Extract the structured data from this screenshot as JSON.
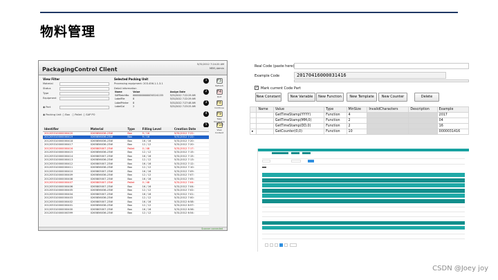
{
  "slide": {
    "title": "物料管理",
    "watermark": "CSDN @Joey joy"
  },
  "shot1": {
    "app_title": "PackagingControl Client",
    "datetime": "5/31/2012 7:24:20 AM",
    "user": "MEK\\ Admin",
    "view_filter": {
      "title": "View Filter",
      "labels": [
        "Material",
        "Status",
        "Type",
        "Equipment"
      ],
      "part_label": "Part",
      "packing_unit_label": "Packing Unit",
      "radio_options": [
        "Box",
        "Pallet",
        "SAP PO"
      ]
    },
    "selected_unit": {
      "title": "Selected Packing Unit",
      "processing_equipment": "Processing equipment: 203.456.1.1.3.1",
      "detail_title": "Detail information",
      "headers": [
        "Name",
        "Value",
        "Assign Date"
      ],
      "rows": [
        [
          "SAPBatchNo",
          "000000000000345241155",
          "5/31/2012 7:22:29 AM"
        ],
        [
          "LabelFile",
          "8",
          "5/31/2012 7:22:29 AM"
        ],
        [
          "LabelPrinter",
          "8",
          "5/31/2012 7:27:48 AM"
        ],
        [
          "LabelCol",
          "2",
          "5/31/2012 7:23:25 AM"
        ]
      ]
    },
    "toolbar": [
      {
        "num": "1",
        "label": "Refresh",
        "icon": "F3"
      },
      {
        "num": "2",
        "label": "Quit",
        "icon": "F4"
      },
      {
        "num": "3",
        "label": "Continue",
        "icon": "F8"
      },
      {
        "num": "4",
        "label": "Take Ownership",
        "icon": "F9"
      },
      {
        "num": "5",
        "label": "View Content",
        "icon": "F10"
      }
    ],
    "grid": {
      "headers": [
        "Identifier",
        "Material",
        "Type",
        "Filling Level",
        "Creation Date"
      ],
      "rows": [
        {
          "c": [
            "201205310000000420",
            "0265856036-23W",
            "Box",
            "9 / 16",
            "5/31/2012 7:22:"
          ],
          "s": "red"
        },
        {
          "c": [
            "201205310000000419",
            "0265856036-23W",
            "Box",
            "9 / 16",
            "5/31/2012 7:22:"
          ],
          "s": "sel"
        },
        {
          "c": [
            "201205310000000418",
            "0265856036-23W",
            "Box",
            "16 / 16",
            "5/31/2012 7:20:"
          ],
          "s": ""
        },
        {
          "c": [
            "201205310000000417",
            "0265856036-23W",
            "Box",
            "12 / 12",
            "5/31/2012 7:20:"
          ],
          "s": ""
        },
        {
          "c": [
            "201205310000000416",
            "0265805007-23W",
            "Pallet",
            "0 / 48",
            "5/31/2012 7:17:"
          ],
          "s": "red"
        },
        {
          "c": [
            "201205310000000415",
            "0265856036-23W",
            "Box",
            "12 / 12",
            "5/31/2012 7:15:"
          ],
          "s": ""
        },
        {
          "c": [
            "201205310000000414",
            "0265805007-23W",
            "Box",
            "16 / 16",
            "5/31/2012 7:15:"
          ],
          "s": ""
        },
        {
          "c": [
            "201205310000000413",
            "0265856036-23W",
            "Box",
            "12 / 12",
            "5/31/2012 7:13:"
          ],
          "s": ""
        },
        {
          "c": [
            "201205310000000412",
            "0265805007-23W",
            "Box",
            "16 / 16",
            "5/31/2012 7:12:"
          ],
          "s": ""
        },
        {
          "c": [
            "201205310000000411",
            "0265856036-23W",
            "Box",
            "12 / 12",
            "5/31/2012 7:10:"
          ],
          "s": ""
        },
        {
          "c": [
            "201205310000000410",
            "0265805007-23W",
            "Box",
            "16 / 16",
            "5/31/2012 7:09:"
          ],
          "s": ""
        },
        {
          "c": [
            "201205310000000409",
            "0265856036-23W",
            "Box",
            "12 / 12",
            "5/31/2012 7:07:"
          ],
          "s": ""
        },
        {
          "c": [
            "201205310000000408",
            "0265805007-23W",
            "Box",
            "16 / 16",
            "5/31/2012 7:05:"
          ],
          "s": ""
        },
        {
          "c": [
            "201205310000000407",
            "0265805007-23W",
            "Pallet",
            "0 / 48",
            "5/31/2012 7:04:"
          ],
          "s": "red"
        },
        {
          "c": [
            "201205310000000406",
            "0265805007-23W",
            "Box",
            "16 / 16",
            "5/31/2012 7:04:"
          ],
          "s": ""
        },
        {
          "c": [
            "201205310000000405",
            "0265856036-23W",
            "Box",
            "12 / 12",
            "5/31/2012 7:02:"
          ],
          "s": ""
        },
        {
          "c": [
            "201205310000000404",
            "0265805007-23W",
            "Box",
            "16 / 16",
            "5/31/2012 7:01:"
          ],
          "s": ""
        },
        {
          "c": [
            "201205310000000403",
            "0265856036-23W",
            "Box",
            "12 / 12",
            "5/31/2012 7:00:"
          ],
          "s": ""
        },
        {
          "c": [
            "201205310000000402",
            "0265805007-23W",
            "Box",
            "16 / 16",
            "5/31/2012 6:58:"
          ],
          "s": ""
        },
        {
          "c": [
            "201205310000000401",
            "0265856036-23W",
            "Box",
            "12 / 12",
            "5/31/2012 6:57:"
          ],
          "s": ""
        },
        {
          "c": [
            "201205310000000400",
            "0265805007-23W",
            "Box",
            "16 / 16",
            "5/31/2012 6:56:"
          ],
          "s": ""
        },
        {
          "c": [
            "201205310000000399",
            "0265856036-23W",
            "Box",
            "12 / 12",
            "5/31/2012 6:54:"
          ],
          "s": ""
        }
      ]
    },
    "status": "Scanner connected"
  },
  "shot2": {
    "real_code_label": "Real Code (paste here)",
    "example_code_label": "Example Code",
    "example_code": "20170416000031416",
    "mark_label": "Mark current Code Part",
    "buttons": [
      "New Constant",
      "New Variable",
      "New Function",
      "New Template",
      "New Counter",
      "Delete"
    ],
    "headers": [
      "Name",
      "Value",
      "Type",
      "MinSize",
      "InvalidCharacters",
      "Description",
      "Example"
    ],
    "rows": [
      {
        "marker": "",
        "c": [
          "",
          "GetTimeStamp(YYYY)",
          "Function",
          "4",
          "",
          "",
          "2017"
        ]
      },
      {
        "marker": "",
        "c": [
          "",
          "GetTimeStamp(MM,0)",
          "Function",
          "2",
          "",
          "",
          "04"
        ]
      },
      {
        "marker": "",
        "c": [
          "",
          "GetTimeStamp(DD,0)",
          "Function",
          "2",
          "",
          "",
          "16"
        ]
      },
      {
        "marker": "▸",
        "c": [
          "",
          "GetCounter(0,0)",
          "Function",
          "10",
          "",
          "",
          "0000031416"
        ]
      }
    ]
  }
}
